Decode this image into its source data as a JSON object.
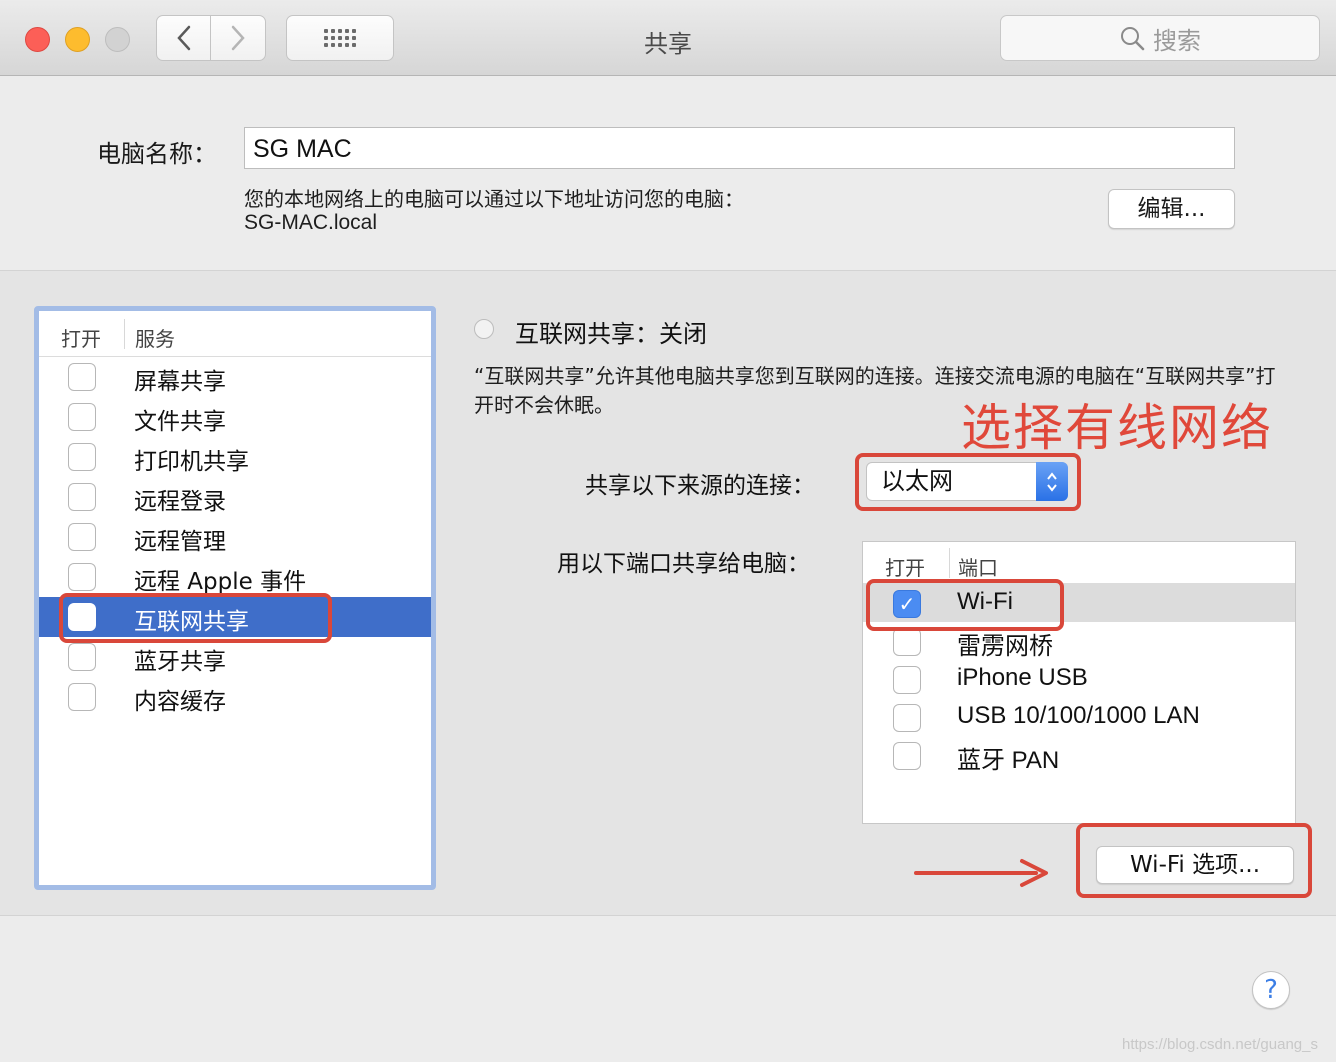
{
  "window": {
    "title": "共享",
    "search_placeholder": "搜索"
  },
  "computer": {
    "name_label": "电脑名称：",
    "name_value": "SG MAC",
    "address_desc": "您的本地网络上的电脑可以通过以下地址访问您的电脑：",
    "address_host": "SG-MAC.local",
    "edit_label": "编辑..."
  },
  "services": {
    "header_on": "打开",
    "header_service": "服务",
    "items": [
      {
        "label": "屏幕共享"
      },
      {
        "label": "文件共享"
      },
      {
        "label": "打印机共享"
      },
      {
        "label": "远程登录"
      },
      {
        "label": "远程管理"
      },
      {
        "label": "远程 Apple 事件"
      },
      {
        "label": "互联网共享"
      },
      {
        "label": "蓝牙共享"
      },
      {
        "label": "内容缓存"
      }
    ],
    "selected": "互联网共享"
  },
  "detail": {
    "status_title": "互联网共享：关闭",
    "description": "“互联网共享”允许其他电脑共享您到互联网的连接。连接交流电源的电脑在“互联网共享”打开时不会休眠。",
    "source_label": "共享以下来源的连接：",
    "source_value": "以太网",
    "ports_label": "用以下端口共享给电脑：",
    "ports_header_on": "打开",
    "ports_header_port": "端口",
    "ports": [
      {
        "label": "Wi-Fi",
        "checked": true
      },
      {
        "label": "雷雳网桥",
        "checked": false
      },
      {
        "label": "iPhone USB",
        "checked": false
      },
      {
        "label": "USB 10/100/1000 LAN",
        "checked": false
      },
      {
        "label": "蓝牙 PAN",
        "checked": false
      }
    ],
    "wifi_options_label": "Wi-Fi 选项...",
    "check_mark": "✓"
  },
  "annotation": {
    "text": "选择有线网络",
    "color": "#d9473a"
  },
  "help_label": "?",
  "watermark": "https://blog.csdn.net/guang_s"
}
